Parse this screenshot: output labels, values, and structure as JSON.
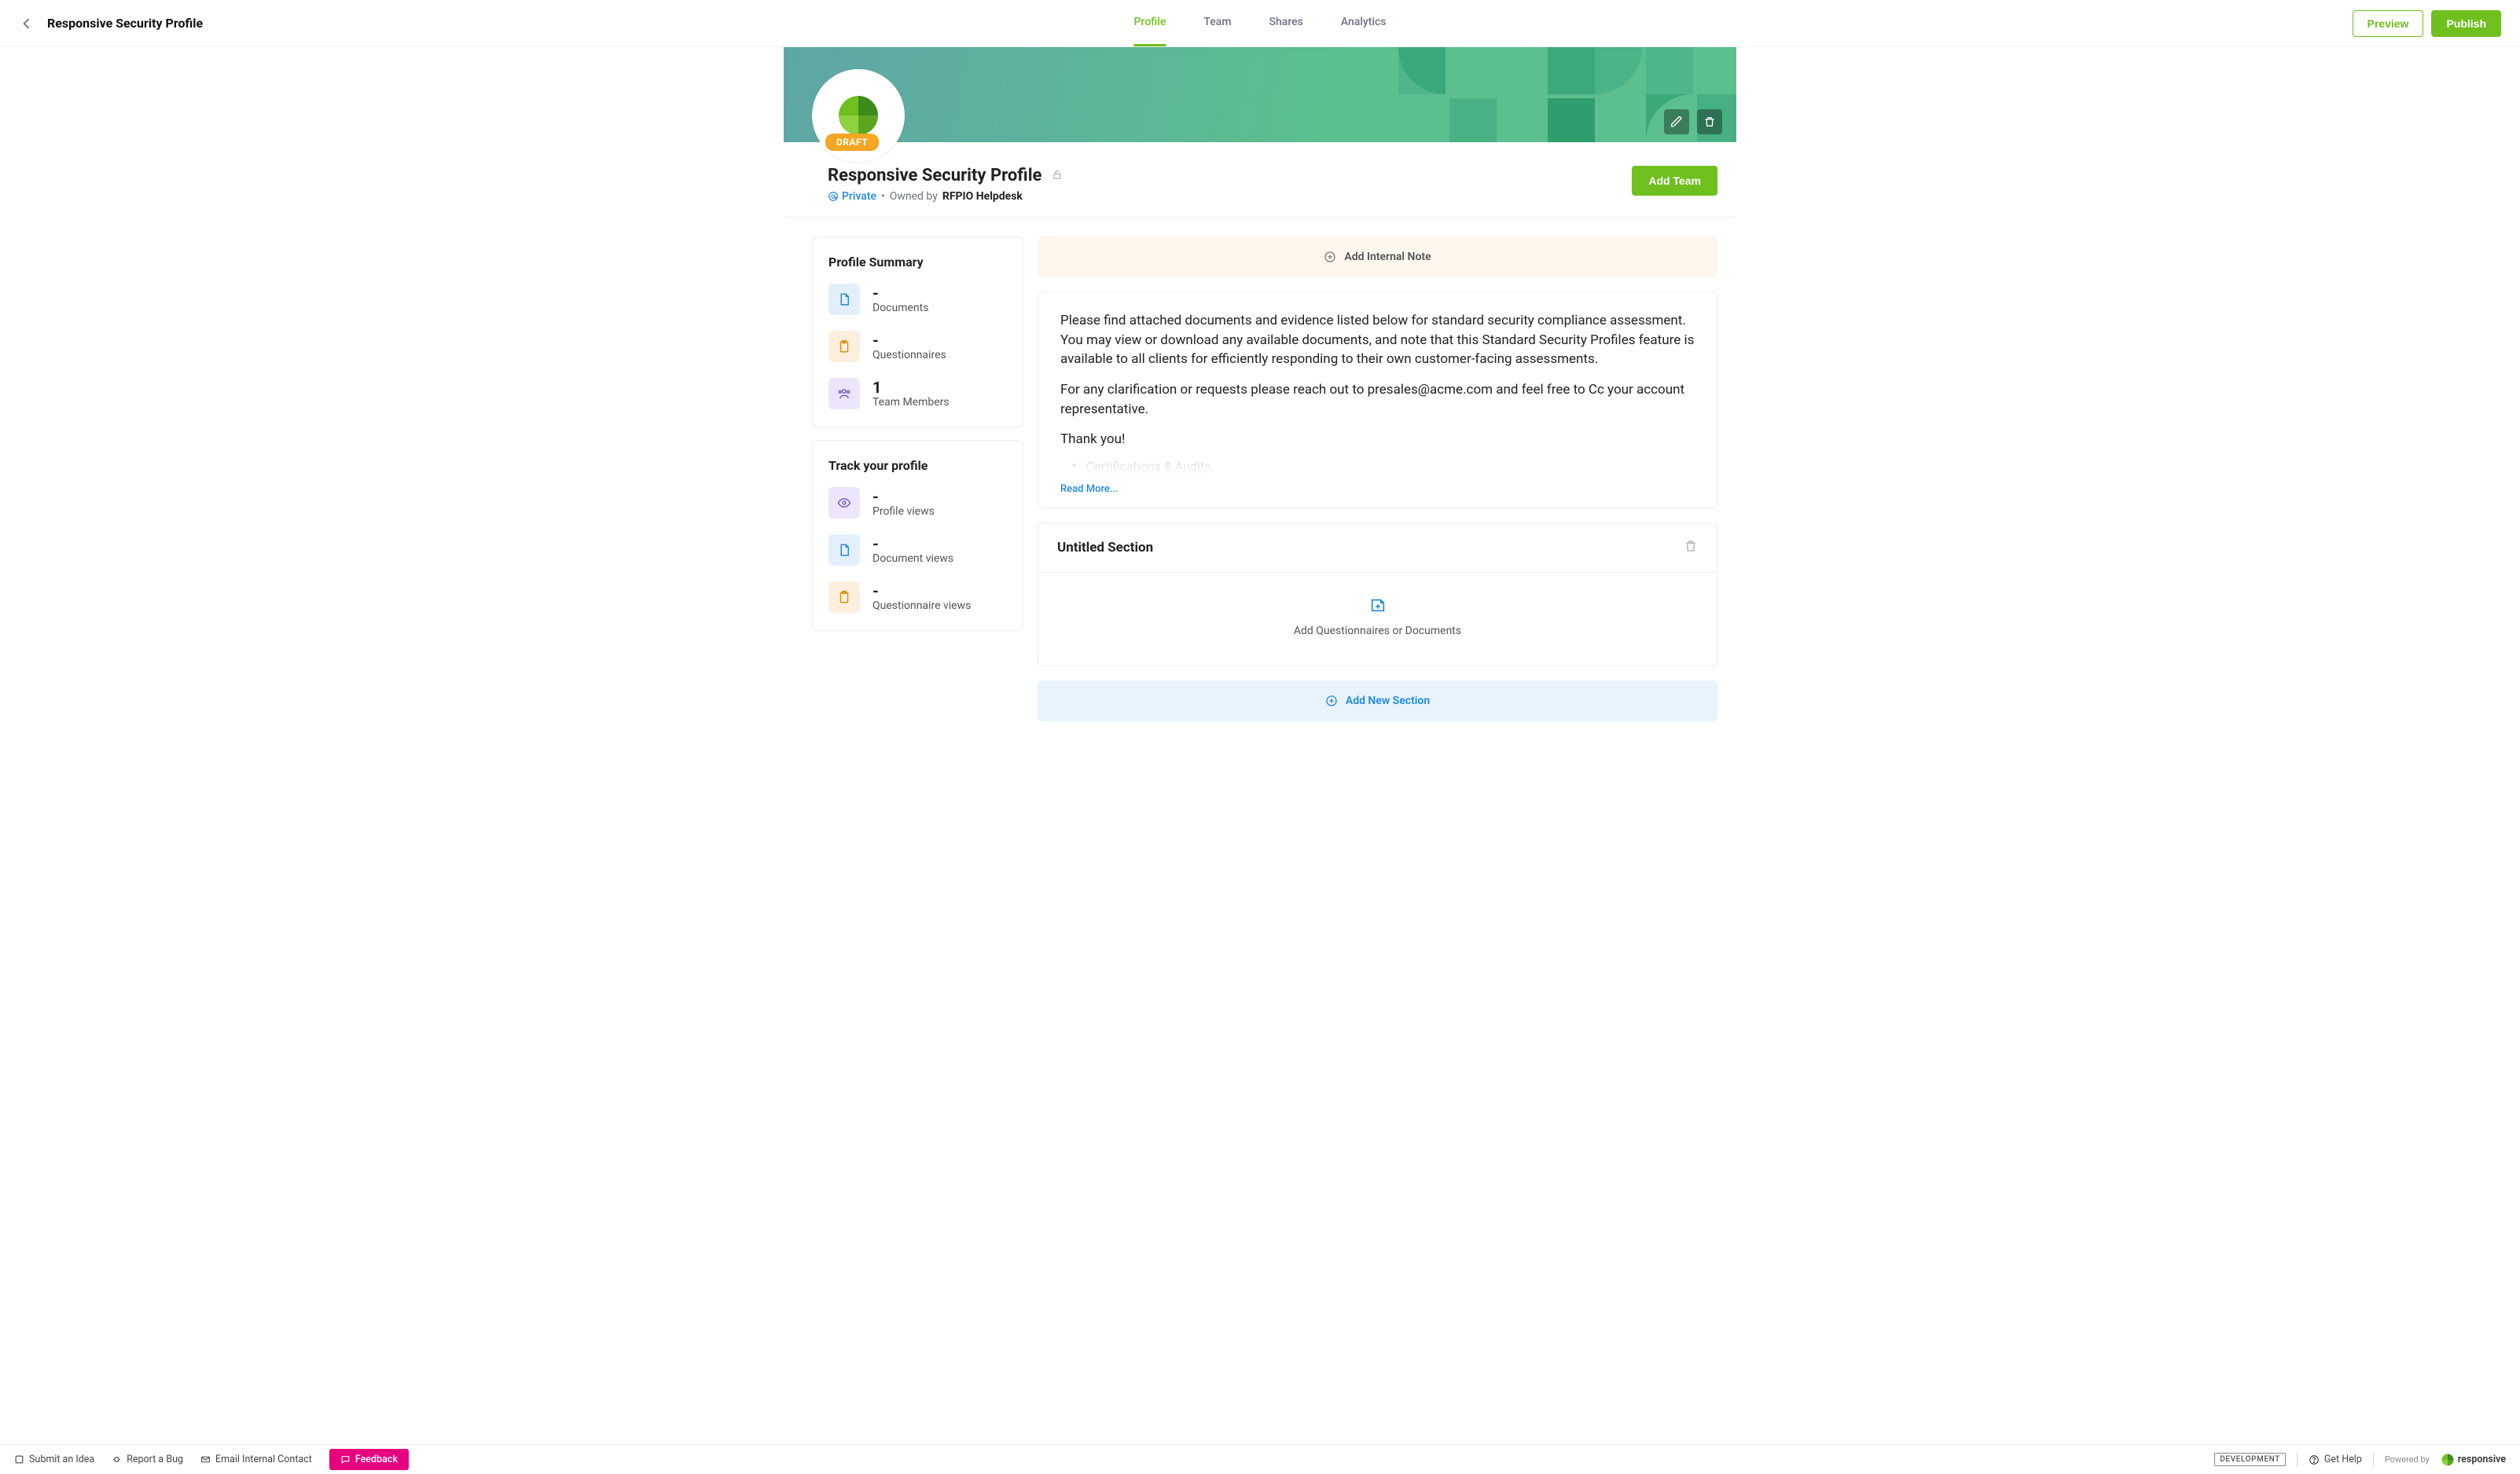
{
  "topbar": {
    "title": "Responsive Security Profile",
    "tabs": [
      {
        "label": "Profile",
        "active": true
      },
      {
        "label": "Team",
        "active": false
      },
      {
        "label": "Shares",
        "active": false
      },
      {
        "label": "Analytics",
        "active": false
      }
    ],
    "preview_label": "Preview",
    "publish_label": "Publish"
  },
  "banner": {
    "draft_badge": "DRAFT",
    "edit_icon": "pencil-icon",
    "delete_icon": "trash-icon"
  },
  "profile": {
    "title": "Responsive Security Profile",
    "visibility": "Private",
    "owned_by_label": "Owned by",
    "owner": "RFPIO Helpdesk",
    "add_team_label": "Add Team"
  },
  "summary": {
    "title": "Profile Summary",
    "items": [
      {
        "value": "-",
        "label": "Documents",
        "icon": "document-icon",
        "tone": "blue"
      },
      {
        "value": "-",
        "label": "Questionnaires",
        "icon": "clipboard-icon",
        "tone": "orange"
      },
      {
        "value": "1",
        "label": "Team Members",
        "icon": "team-icon",
        "tone": "purple"
      }
    ]
  },
  "tracking": {
    "title": "Track your profile",
    "items": [
      {
        "value": "-",
        "label": "Profile views",
        "icon": "eye-icon",
        "tone": "purple"
      },
      {
        "value": "-",
        "label": "Document views",
        "icon": "document-icon",
        "tone": "blue"
      },
      {
        "value": "-",
        "label": "Questionnaire views",
        "icon": "clipboard-icon",
        "tone": "orange"
      }
    ]
  },
  "main": {
    "add_note_label": "Add Internal Note",
    "description": {
      "p1": "Please find attached documents and evidence listed below for standard security compliance assessment. You may view or download any available documents, and note that this Standard Security Profiles feature is available to all clients for efficiently responding to their own customer-facing assessments.",
      "p2": "For any clarification or requests please reach out to presales@acme.com and feel free to Cc your account representative.",
      "p3": "Thank you!",
      "bullet1": "Certifications & Audits",
      "read_more": "Read More..."
    },
    "section": {
      "title": "Untitled Section",
      "add_content_label": "Add Questionnaires or Documents"
    },
    "add_section_label": "Add New Section"
  },
  "footer": {
    "submit_idea": "Submit an Idea",
    "report_bug": "Report a Bug",
    "email_contact": "Email Internal Contact",
    "feedback": "Feedback",
    "dev_badge": "DEVELOPMENT",
    "get_help": "Get Help",
    "powered_by": "Powered by",
    "brand": "responsive"
  },
  "colors": {
    "accent_green": "#6fbf1f",
    "accent_blue": "#1e88e5",
    "badge_orange": "#f5a623",
    "feedback_pink": "#e6007e"
  }
}
